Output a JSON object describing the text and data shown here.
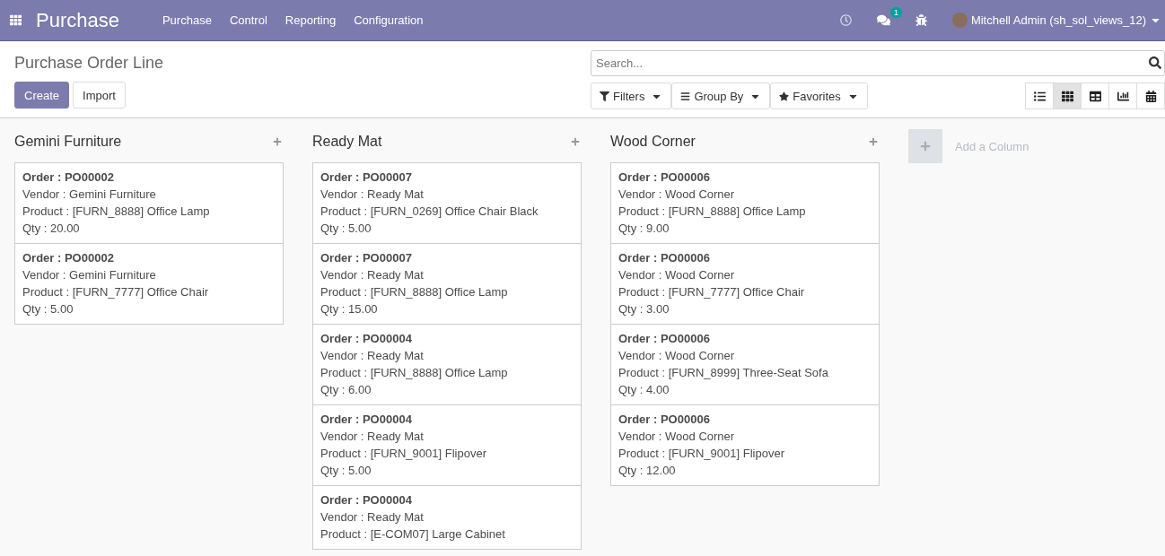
{
  "navbar": {
    "app_title": "Purchase",
    "menus": [
      "Purchase",
      "Control",
      "Reporting",
      "Configuration"
    ],
    "messages_badge": "1",
    "user": "Mitchell Admin (sh_sol_views_12)"
  },
  "control_panel": {
    "breadcrumb": "Purchase Order Line",
    "buttons": [
      "Create",
      "Import"
    ],
    "search": {
      "placeholder": "Search..."
    },
    "filters": [
      "Filters",
      "Group By",
      "Favorites"
    ],
    "views": [
      {
        "kind": "list",
        "selected": false
      },
      {
        "kind": "kanban",
        "selected": true
      },
      {
        "kind": "pivot",
        "selected": false
      },
      {
        "kind": "graph",
        "selected": false
      },
      {
        "kind": "calendar",
        "selected": false
      }
    ]
  },
  "columns": [
    {
      "title": "Gemini Furniture",
      "cards": [
        {
          "lines": [
            "Order : PO00002",
            "Vendor : Gemini Furniture",
            "Product : [FURN_8888] Office Lamp",
            "Qty : 20.00"
          ]
        },
        {
          "lines": [
            "Order : PO00002",
            "Vendor : Gemini Furniture",
            "Product : [FURN_7777] Office Chair",
            "Qty : 5.00"
          ]
        }
      ]
    },
    {
      "title": "Ready Mat",
      "cards": [
        {
          "lines": [
            "Order : PO00007",
            "Vendor : Ready Mat",
            "Product : [FURN_0269] Office Chair Black",
            "Qty : 5.00"
          ]
        },
        {
          "lines": [
            "Order : PO00007",
            "Vendor : Ready Mat",
            "Product : [FURN_8888] Office Lamp",
            "Qty : 15.00"
          ]
        },
        {
          "lines": [
            "Order : PO00004",
            "Vendor : Ready Mat",
            "Product : [FURN_8888] Office Lamp",
            "Qty : 6.00"
          ]
        },
        {
          "lines": [
            "Order : PO00004",
            "Vendor : Ready Mat",
            "Product : [FURN_9001] Flipover",
            "Qty : 5.00"
          ]
        },
        {
          "lines": [
            "Order : PO00004",
            "Vendor : Ready Mat",
            "Product : [E-COM07] Large Cabinet"
          ]
        }
      ]
    },
    {
      "title": "Wood Corner",
      "cards": [
        {
          "lines": [
            "Order : PO00006",
            "Vendor : Wood Corner",
            "Product : [FURN_8888] Office Lamp",
            "Qty : 9.00"
          ]
        },
        {
          "lines": [
            "Order : PO00006",
            "Vendor : Wood Corner",
            "Product : [FURN_7777] Office Chair",
            "Qty : 3.00"
          ]
        },
        {
          "lines": [
            "Order : PO00006",
            "Vendor : Wood Corner",
            "Product : [FURN_8999] Three-Seat Sofa",
            "Qty : 4.00"
          ]
        },
        {
          "lines": [
            "Order : PO00006",
            "Vendor : Wood Corner",
            "Product : [FURN_9001] Flipover",
            "Qty : 12.00"
          ]
        }
      ]
    }
  ],
  "add_column": "Add a Column"
}
